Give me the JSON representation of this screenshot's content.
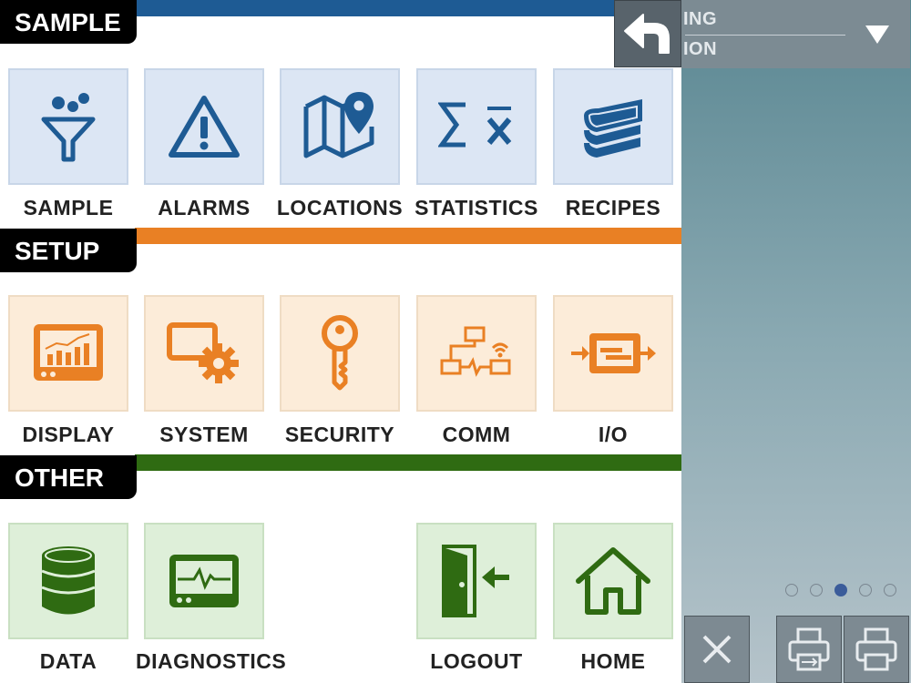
{
  "colors": {
    "sample_bar": "#1e5b94",
    "setup_bar": "#e98024",
    "other_bar": "#2f6b12",
    "blue_icon": "#1e5b94",
    "orange_icon": "#e98024",
    "green_icon": "#2f6b12"
  },
  "status": {
    "line1": "ING",
    "line2": "ION"
  },
  "sections": {
    "sample": "SAMPLE",
    "setup": "SETUP",
    "other": "OTHER"
  },
  "tiles": {
    "sample": "SAMPLE",
    "alarms": "ALARMS",
    "locations": "LOCATIONS",
    "statistics": "STATISTICS",
    "recipes": "RECIPES",
    "display": "DISPLAY",
    "system": "SYSTEM",
    "security": "SECURITY",
    "comm": "COMM",
    "io": "I/O",
    "data": "DATA",
    "diagnostics": "DIAGNOSTICS",
    "logout": "LOGOUT",
    "home": "HOME"
  },
  "pager": {
    "count": 5,
    "active_index": 2
  },
  "icons": {
    "back": "back-arrow-icon",
    "dropdown": "triangle-down-icon",
    "close": "close-icon",
    "usb_print": "usb-printer-icon",
    "print": "printer-icon"
  }
}
